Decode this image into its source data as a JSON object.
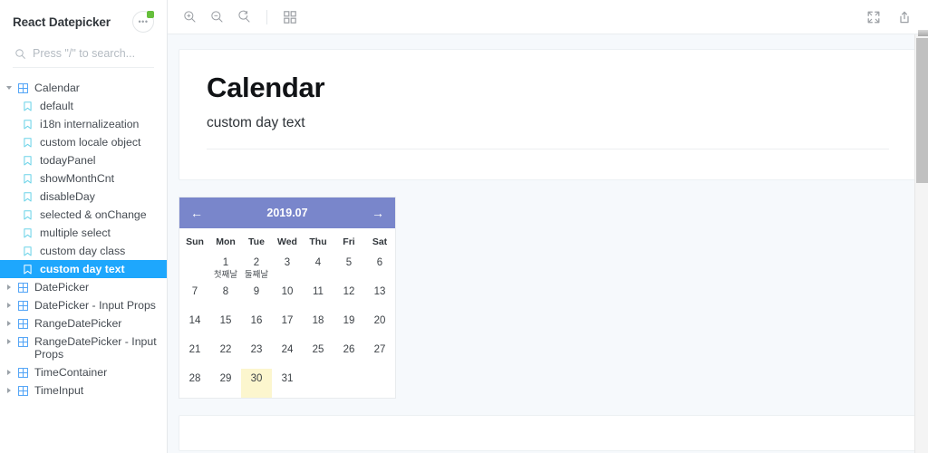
{
  "sidebar": {
    "title": "React Datepicker",
    "menu_button": {
      "name": "more-options",
      "glyph": "●●●",
      "badge": true
    },
    "search": {
      "placeholder": "Press \"/\" to search...",
      "value": "",
      "icon": "search-icon"
    },
    "tree": [
      {
        "label": "Calendar",
        "type": "group",
        "expanded": true,
        "depth": 0,
        "selected": false
      },
      {
        "label": "default",
        "type": "story",
        "depth": 1,
        "selected": false
      },
      {
        "label": "i18n internalizeation",
        "type": "story",
        "depth": 1,
        "selected": false
      },
      {
        "label": "custom locale object",
        "type": "story",
        "depth": 1,
        "selected": false
      },
      {
        "label": "todayPanel",
        "type": "story",
        "depth": 1,
        "selected": false
      },
      {
        "label": "showMonthCnt",
        "type": "story",
        "depth": 1,
        "selected": false
      },
      {
        "label": "disableDay",
        "type": "story",
        "depth": 1,
        "selected": false
      },
      {
        "label": "selected & onChange",
        "type": "story",
        "depth": 1,
        "selected": false
      },
      {
        "label": "multiple select",
        "type": "story",
        "depth": 1,
        "selected": false
      },
      {
        "label": "custom day class",
        "type": "story",
        "depth": 1,
        "selected": false
      },
      {
        "label": "custom day text",
        "type": "story",
        "depth": 1,
        "selected": true
      },
      {
        "label": "DatePicker",
        "type": "group",
        "expanded": false,
        "depth": 0,
        "selected": false
      },
      {
        "label": "DatePicker - Input Props",
        "type": "group",
        "expanded": false,
        "depth": 0,
        "selected": false
      },
      {
        "label": "RangeDatePicker",
        "type": "group",
        "expanded": false,
        "depth": 0,
        "selected": false
      },
      {
        "label": "RangeDatePicker - Input Props",
        "type": "group",
        "expanded": false,
        "depth": 0,
        "selected": false
      },
      {
        "label": "TimeContainer",
        "type": "group",
        "expanded": false,
        "depth": 0,
        "selected": false
      },
      {
        "label": "TimeInput",
        "type": "group",
        "expanded": false,
        "depth": 0,
        "selected": false
      }
    ]
  },
  "toolbar": {
    "left": [
      {
        "name": "zoom-in-icon",
        "title": "Zoom in"
      },
      {
        "name": "zoom-out-icon",
        "title": "Zoom out"
      },
      {
        "name": "zoom-reset-icon",
        "title": "Reset zoom"
      },
      {
        "name": "grid-background-icon",
        "title": "Change background"
      }
    ],
    "right": [
      {
        "name": "fullscreen-icon",
        "title": "Go full screen"
      },
      {
        "name": "open-in-new-tab-icon",
        "title": "Open canvas in new tab"
      }
    ]
  },
  "story": {
    "heading": "Calendar",
    "subheading": "custom day text"
  },
  "calendar": {
    "prev_label": "←",
    "next_label": "→",
    "month_label": "2019.07",
    "weekdays": [
      "Sun",
      "Mon",
      "Tue",
      "Wed",
      "Thu",
      "Fri",
      "Sat"
    ],
    "accent_color": "#7986cb",
    "today_bg": "#fcf6ce",
    "sunday_color": "#f2483f",
    "saturday_color": "#3d3df0",
    "weeks": [
      [
        {
          "day": "",
          "text": ""
        },
        {
          "day": "1",
          "text": "첫째날"
        },
        {
          "day": "2",
          "text": "둘째날"
        },
        {
          "day": "3",
          "text": ""
        },
        {
          "day": "4",
          "text": ""
        },
        {
          "day": "5",
          "text": ""
        },
        {
          "day": "6",
          "text": ""
        }
      ],
      [
        {
          "day": "7",
          "text": ""
        },
        {
          "day": "8",
          "text": ""
        },
        {
          "day": "9",
          "text": ""
        },
        {
          "day": "10",
          "text": ""
        },
        {
          "day": "11",
          "text": ""
        },
        {
          "day": "12",
          "text": ""
        },
        {
          "day": "13",
          "text": ""
        }
      ],
      [
        {
          "day": "14",
          "text": ""
        },
        {
          "day": "15",
          "text": ""
        },
        {
          "day": "16",
          "text": ""
        },
        {
          "day": "17",
          "text": ""
        },
        {
          "day": "18",
          "text": ""
        },
        {
          "day": "19",
          "text": ""
        },
        {
          "day": "20",
          "text": ""
        }
      ],
      [
        {
          "day": "21",
          "text": ""
        },
        {
          "day": "22",
          "text": ""
        },
        {
          "day": "23",
          "text": ""
        },
        {
          "day": "24",
          "text": ""
        },
        {
          "day": "25",
          "text": ""
        },
        {
          "day": "26",
          "text": ""
        },
        {
          "day": "27",
          "text": ""
        }
      ],
      [
        {
          "day": "28",
          "text": ""
        },
        {
          "day": "29",
          "text": ""
        },
        {
          "day": "30",
          "text": "",
          "today": true
        },
        {
          "day": "31",
          "text": ""
        },
        {
          "day": "",
          "text": ""
        },
        {
          "day": "",
          "text": ""
        },
        {
          "day": "",
          "text": ""
        }
      ]
    ]
  }
}
